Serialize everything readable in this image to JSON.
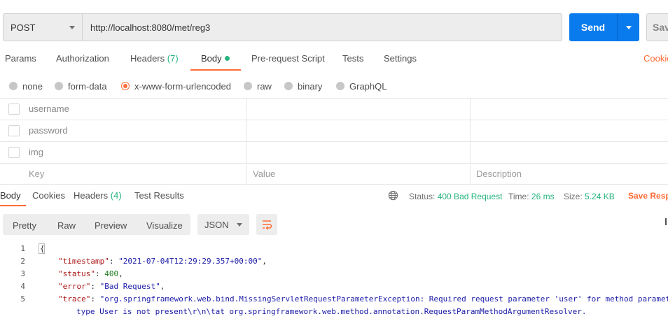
{
  "request": {
    "method": "POST",
    "url": "http://localhost:8080/met/reg3",
    "send_label": "Send",
    "save_label": "Save"
  },
  "tabs": {
    "params": "Params",
    "authorization": "Authorization",
    "headers": "Headers",
    "headers_count": "(7)",
    "body": "Body",
    "prerequest": "Pre-request Script",
    "tests": "Tests",
    "settings": "Settings",
    "cookies": "Cookies"
  },
  "body_types": {
    "none": "none",
    "form_data": "form-data",
    "urlencoded": "x-www-form-urlencoded",
    "raw": "raw",
    "binary": "binary",
    "graphql": "GraphQL",
    "selected": "x-www-form-urlencoded"
  },
  "params_table": {
    "rows": [
      {
        "key": "username",
        "value": "",
        "description": ""
      },
      {
        "key": "password",
        "value": "",
        "description": ""
      },
      {
        "key": "img",
        "value": "",
        "description": ""
      }
    ],
    "placeholder": {
      "key": "Key",
      "value": "Value",
      "description": "Description"
    }
  },
  "response_tabs": {
    "body": "Body",
    "cookies": "Cookies",
    "headers": "Headers",
    "headers_count": "(4)",
    "test_results": "Test Results"
  },
  "status": {
    "status_label": "Status:",
    "status_value": "400 Bad Request",
    "time_label": "Time:",
    "time_value": "26 ms",
    "size_label": "Size:",
    "size_value": "5.24 KB",
    "save_response": "Save Response"
  },
  "view": {
    "pretty": "Pretty",
    "raw": "Raw",
    "preview": "Preview",
    "visualize": "Visualize",
    "format": "JSON"
  },
  "code": {
    "line_numbers": [
      "1",
      "2",
      "3",
      "4",
      "5"
    ],
    "open_brace": "{",
    "timestamp_key": "\"timestamp\"",
    "timestamp_value": "\"2021-07-04T12:29:29.357+00:00\"",
    "status_key": "\"status\"",
    "status_value": "400",
    "error_key": "\"error\"",
    "error_value": "\"Bad Request\"",
    "trace_key": "\"trace\"",
    "trace_value": "\"org.springframework.web.bind.MissingServletRequestParameterException: Required request parameter 'user' for method parameter",
    "trace_continued": "type User is not present\\r\\n\\tat org.springframework.web.method.annotation.RequestParamMethodArgumentResolver."
  },
  "icons": {
    "globe": "globe-icon",
    "wrap": "wrap-lines-icon",
    "caret": "chevron-down-icon"
  },
  "colors": {
    "accent": "#ff6c37",
    "send": "#097bed",
    "success": "#26b47f"
  }
}
